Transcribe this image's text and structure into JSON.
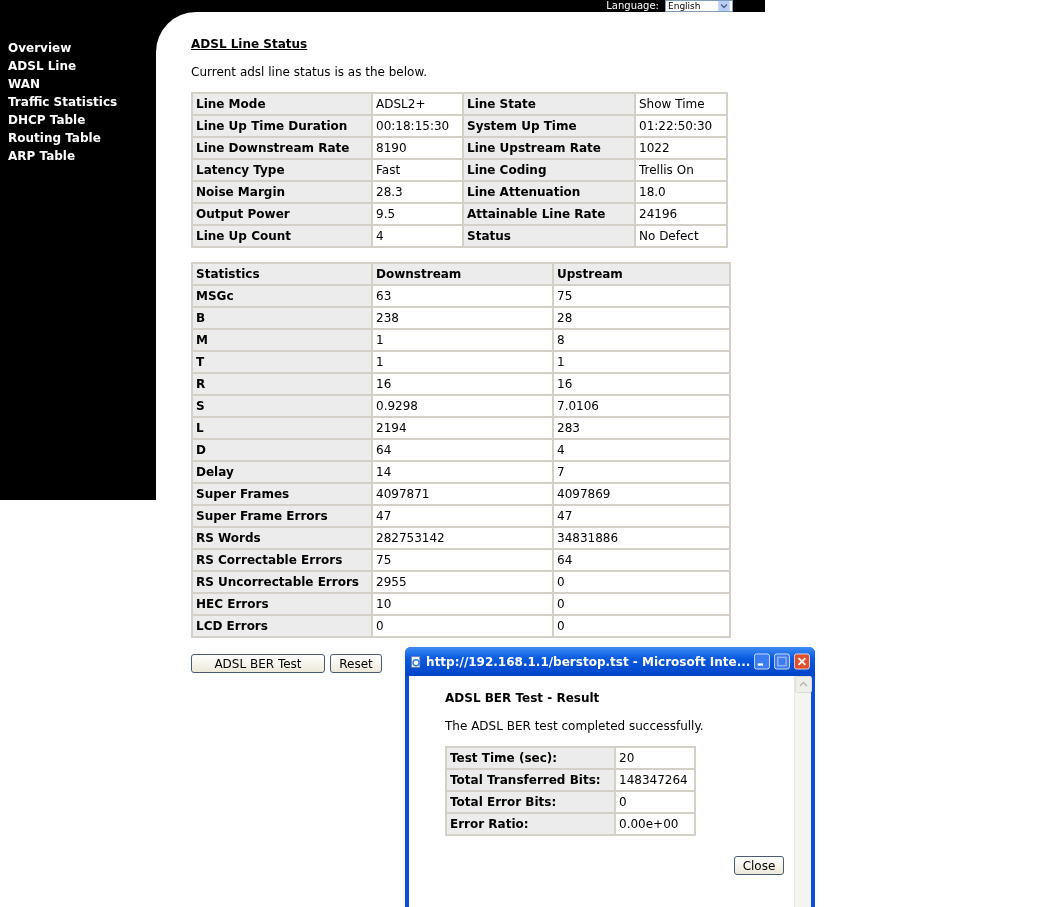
{
  "header": {
    "language_label": "Language:",
    "language_value": "English"
  },
  "sidebar": {
    "items": [
      {
        "label": "Overview"
      },
      {
        "label": "ADSL Line"
      },
      {
        "label": "WAN"
      },
      {
        "label": "Traffic Statistics"
      },
      {
        "label": "DHCP Table"
      },
      {
        "label": "Routing Table"
      },
      {
        "label": "ARP Table"
      }
    ]
  },
  "title": "ADSL Line Status",
  "description": "Current adsl line status is as the below.",
  "line_status": [
    [
      "Line Mode",
      "ADSL2+",
      "Line State",
      "Show Time"
    ],
    [
      "Line Up Time Duration",
      "00:18:15:30",
      "System Up Time",
      "01:22:50:30"
    ],
    [
      "Line Downstream Rate",
      "8190",
      "Line Upstream Rate",
      "1022"
    ],
    [
      "Latency Type",
      "Fast",
      "Line Coding",
      "Trellis On"
    ],
    [
      "Noise Margin",
      "28.3",
      "Line Attenuation",
      "18.0"
    ],
    [
      "Output Power",
      "9.5",
      "Attainable Line Rate",
      "24196"
    ],
    [
      "Line Up Count",
      "4",
      "Status",
      "No Defect"
    ]
  ],
  "statistics": {
    "columns": [
      "Statistics",
      "Downstream",
      "Upstream"
    ],
    "rows": [
      [
        "MSGc",
        "63",
        "75"
      ],
      [
        "B",
        "238",
        "28"
      ],
      [
        "M",
        "1",
        "8"
      ],
      [
        "T",
        "1",
        "1"
      ],
      [
        "R",
        "16",
        "16"
      ],
      [
        "S",
        "0.9298",
        "7.0106"
      ],
      [
        "L",
        "2194",
        "283"
      ],
      [
        "D",
        "64",
        "4"
      ],
      [
        "Delay",
        "14",
        "7"
      ],
      [
        "Super Frames",
        "4097871",
        "4097869"
      ],
      [
        "Super Frame Errors",
        "47",
        "47"
      ],
      [
        "RS Words",
        "282753142",
        "34831886"
      ],
      [
        "RS Correctable Errors",
        "75",
        "64"
      ],
      [
        "RS Uncorrectable Errors",
        "2955",
        "0"
      ],
      [
        "HEC Errors",
        "10",
        "0"
      ],
      [
        "LCD Errors",
        "0",
        "0"
      ]
    ]
  },
  "buttons": [
    "ADSL BER Test",
    "Reset"
  ],
  "popup": {
    "title": "http://192.168.1.1/berstop.tst - Microsoft Inte...",
    "heading": "ADSL BER Test - Result",
    "message": "The ADSL BER test completed successfully.",
    "results": [
      [
        "Test Time (sec):",
        "20"
      ],
      [
        "Total Transferred Bits:",
        "148347264"
      ],
      [
        "Total Error Bits:",
        "0"
      ],
      [
        "Error Ratio:",
        "0.00e+00"
      ]
    ],
    "close_button": "Close"
  }
}
